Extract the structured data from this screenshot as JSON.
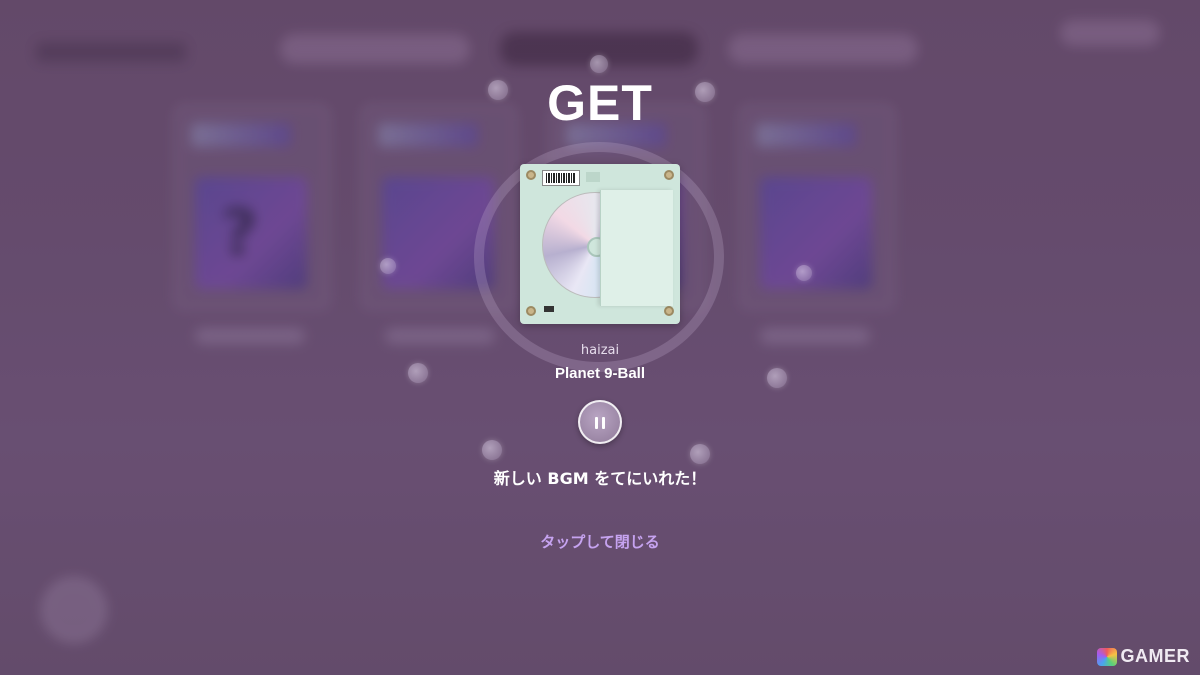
{
  "popup": {
    "title": "GET",
    "artist": "haizai",
    "track_title": "Planet 9-Ball",
    "message": "新しい BGM をてにいれた！",
    "close_label": "タップして閉じる"
  },
  "player": {
    "state": "playing",
    "pause_icon": "pause-icon"
  },
  "watermark": {
    "text": "GAMER"
  },
  "colors": {
    "background": "#6c5273",
    "accent_link": "#c6a3f0",
    "disc_case": "#cfe6dc"
  }
}
